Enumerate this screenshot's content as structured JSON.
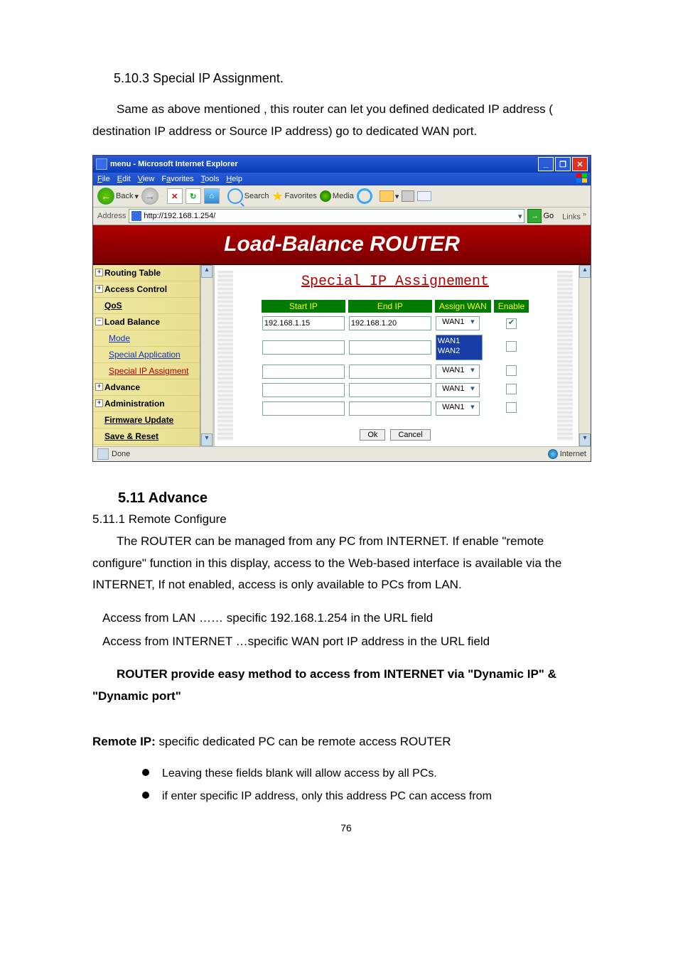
{
  "doc": {
    "sec5103_head": "5.10.3  Special IP Assignment.",
    "sec5103_para": "Same as above mentioned , this router can let you defined dedicated IP address ( destination IP address or Source IP address) go to dedicated WAN port.",
    "sec511_head": "5.11 Advance",
    "sec5111_head": "5.11.1 Remote Configure",
    "sec5111_para": "The ROUTER can be managed from any PC from INTERNET. If enable \"remote configure\" function in this display, access to the Web-based interface is available via the INTERNET, If not enabled, access is only available to PCs from LAN.",
    "access_lan": "Access from LAN …… specific 192.168.1.254 in the URL field",
    "access_inet": "Access from INTERNET …specific WAN port IP address in the URL field",
    "bold1": "ROUTER provide easy method to access from INTERNET via \"Dynamic IP\" & \"Dynamic port\"",
    "remoteip_head": "Remote IP:",
    "remoteip_tail": " specific dedicated PC can be remote access ROUTER",
    "bullet1": "Leaving these fields blank will allow access by all PCs.",
    "bullet2": "if enter specific IP address, only this address PC can access from",
    "page_number": "76"
  },
  "window": {
    "title": "menu - Microsoft Internet Explorer",
    "menu": {
      "file": "File",
      "edit": "Edit",
      "view": "View",
      "favorites": "Favorites",
      "tools": "Tools",
      "help": "Help"
    },
    "toolbar": {
      "back": "Back",
      "search": "Search",
      "favorites": "Favorites",
      "media": "Media"
    },
    "address_label": "Address",
    "address_value": "http://192.168.1.254/",
    "go_label": "Go",
    "links_label": "Links",
    "banner": "Load-Balance ROUTER",
    "status_done": "Done",
    "status_zone": "Internet"
  },
  "sidebar": {
    "routing": "Routing Table",
    "access": "Access Control",
    "qos": "QoS",
    "loadbal": "Load Balance",
    "mode": "Mode",
    "spapp": "Special Application",
    "spip": "Special IP Assigment",
    "advance": "Advance",
    "admin": "Administration",
    "fw": "Firmware Update",
    "save": "Save & Reset"
  },
  "content": {
    "page_title": "Special IP Assignement",
    "headers": {
      "start": "Start IP",
      "end": "End IP",
      "assign": "Assign WAN",
      "enable": "Enable"
    },
    "rows": [
      {
        "start": "192.168.1.15",
        "end": "192.168.1.20",
        "wan": "WAN1",
        "open": false,
        "checked": true
      },
      {
        "start": "",
        "end": "",
        "wan": "WAN1\nWAN2",
        "open": true,
        "checked": false
      },
      {
        "start": "",
        "end": "",
        "wan": "WAN1",
        "open": false,
        "checked": false
      },
      {
        "start": "",
        "end": "",
        "wan": "WAN1",
        "open": false,
        "checked": false
      },
      {
        "start": "",
        "end": "",
        "wan": "WAN1",
        "open": false,
        "checked": false
      }
    ],
    "ok": "Ok",
    "cancel": "Cancel"
  }
}
